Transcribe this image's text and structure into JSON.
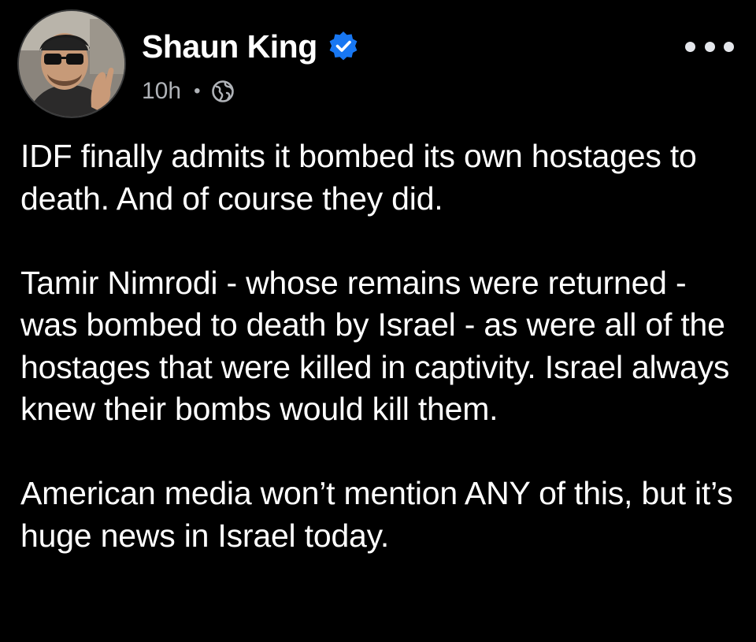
{
  "post": {
    "author": {
      "name": "Shaun King",
      "verified": true,
      "verified_color": "#1877f2"
    },
    "timestamp": "10h",
    "separator": "•",
    "audience_icon": "globe-icon",
    "more_icon": "more-options-icon",
    "paragraphs": [
      "IDF finally admits it bombed its own hostages to death. And of course they did.",
      "Tamir Nimrodi - whose remains were returned - was bombed to death by Israel - as were all of the hostages that were killed in captivity. Israel always knew their bombs would kill them.",
      "American media won’t mention ANY of this, but it’s huge news in Israel today."
    ]
  },
  "colors": {
    "background": "#000000",
    "text_primary": "#ffffff",
    "text_secondary": "#b0b3b8"
  }
}
